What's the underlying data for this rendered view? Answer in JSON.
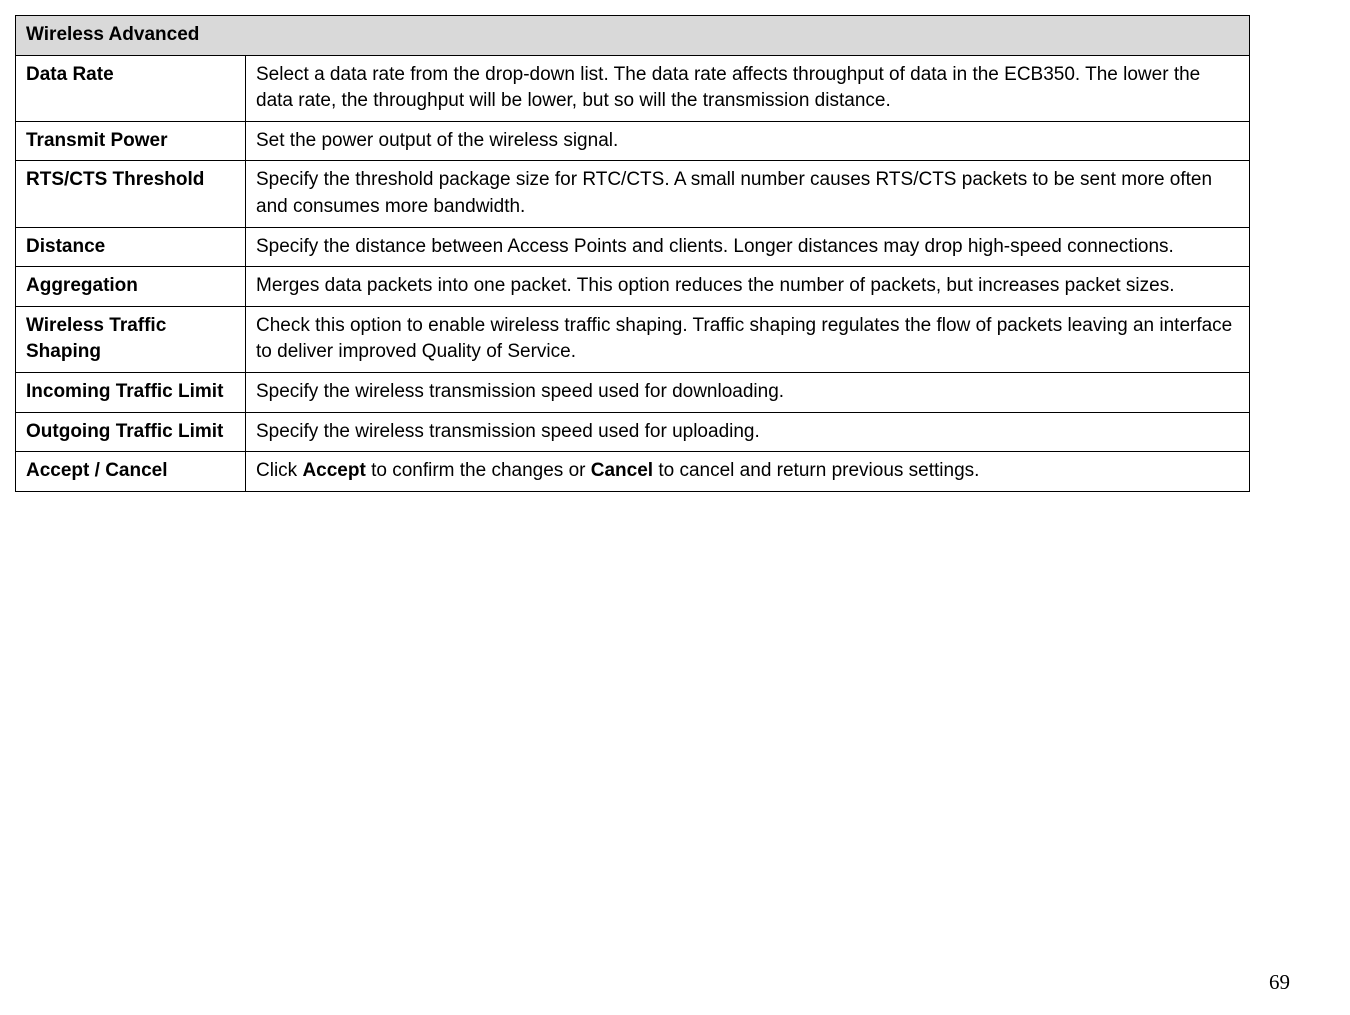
{
  "table": {
    "title": "Wireless Advanced",
    "rows": [
      {
        "label": "Data Rate",
        "desc": "Select a data rate from the drop-down list. The data rate affects throughput of data in the ECB350. The lower the data rate, the throughput will be lower, but so will the transmission distance."
      },
      {
        "label": "Transmit Power",
        "desc": "Set the power output of the wireless signal."
      },
      {
        "label": "RTS/CTS Threshold",
        "desc": "Specify the threshold package size for RTC/CTS. A small number causes RTS/CTS packets to be sent more often and consumes more bandwidth."
      },
      {
        "label": "Distance",
        "desc": "Specify the distance between Access Points and clients. Longer distances may drop high-speed connections."
      },
      {
        "label": "Aggregation",
        "desc": "Merges data packets into one packet. This option reduces the number of packets, but increases packet sizes."
      },
      {
        "label": "Wireless Traffic Shaping",
        "desc": "Check this option to enable wireless traffic shaping. Traffic shaping regulates the flow of packets leaving an interface to deliver improved Quality of Service."
      },
      {
        "label": "Incoming Traffic Limit",
        "desc": "Specify the wireless transmission speed used for downloading."
      },
      {
        "label": "Outgoing Traffic Limit",
        "desc": "Specify the wireless transmission speed used for uploading."
      },
      {
        "label": "Accept / Cancel",
        "desc_parts": [
          "Click ",
          "Accept",
          " to confirm the changes or ",
          "Cancel",
          " to cancel and return previous settings."
        ]
      }
    ]
  },
  "page_number": "69"
}
